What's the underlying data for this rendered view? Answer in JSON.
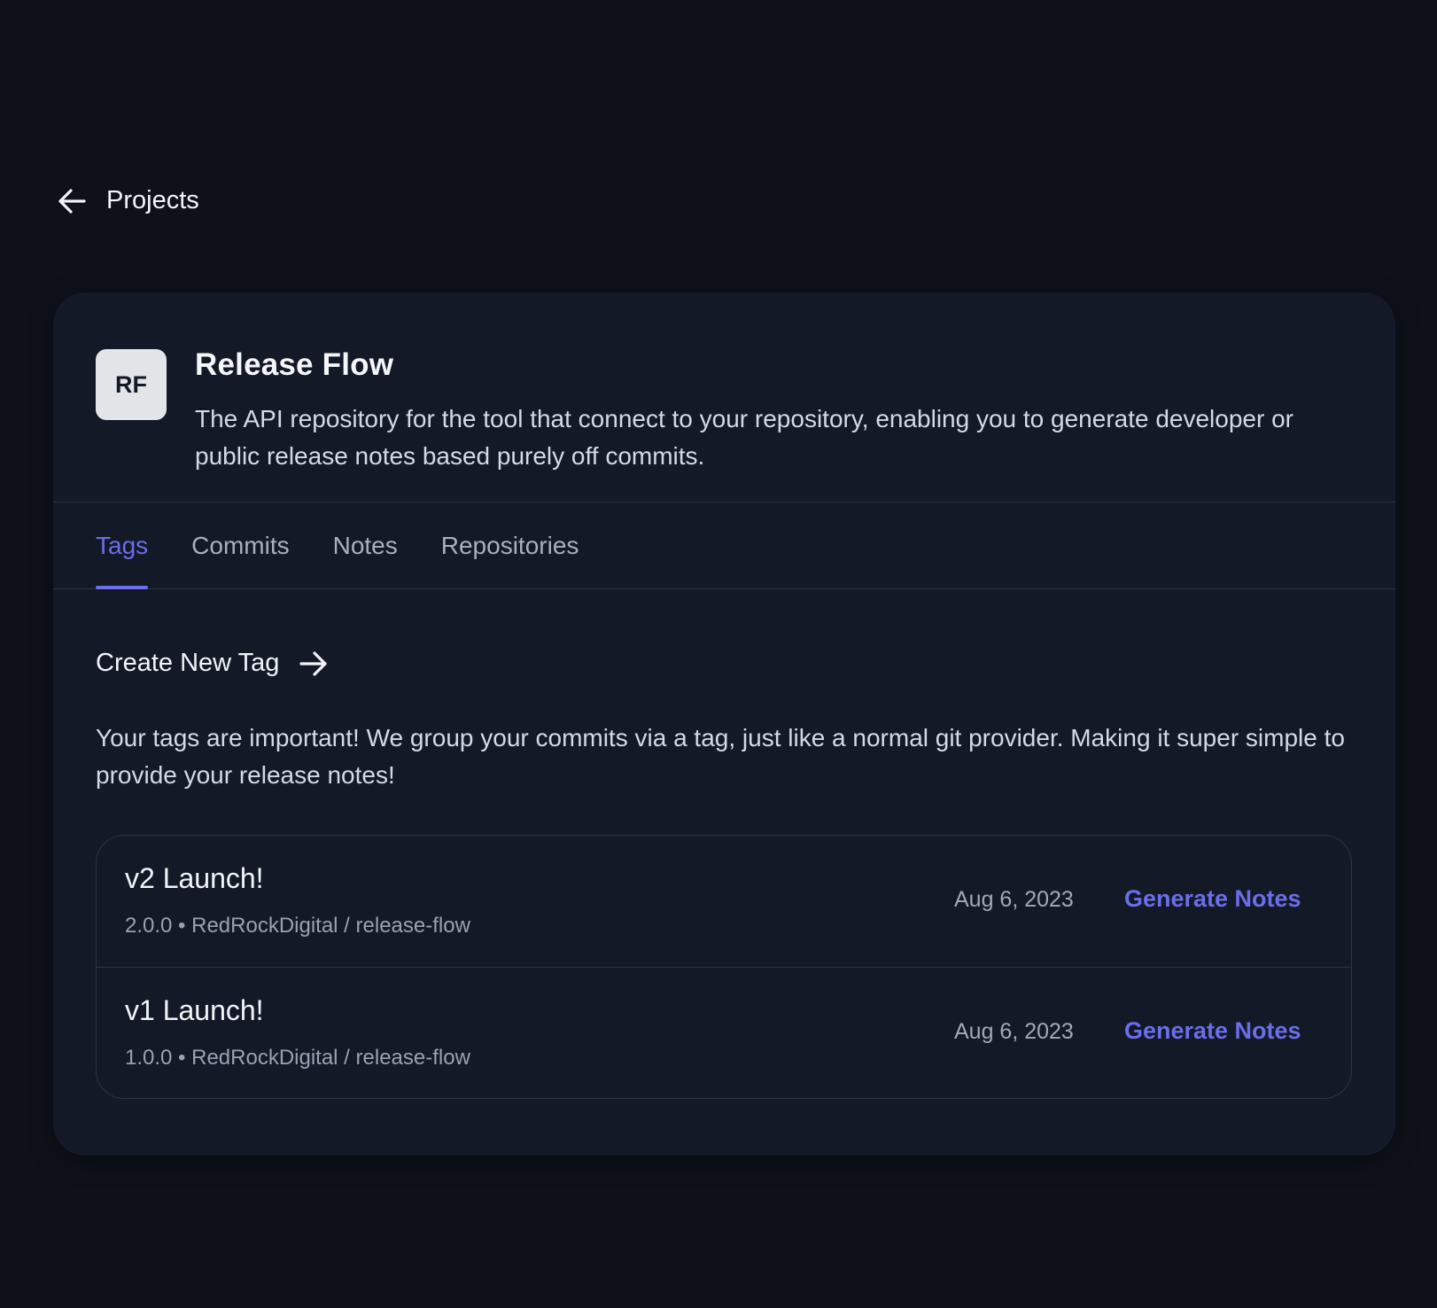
{
  "nav": {
    "back_label": "Projects"
  },
  "project": {
    "initials": "RF",
    "title": "Release Flow",
    "description": "The API repository for the tool that connect to your repository, enabling you to generate developer or public release notes based purely off commits."
  },
  "tabs": [
    {
      "label": "Tags",
      "active": true
    },
    {
      "label": "Commits",
      "active": false
    },
    {
      "label": "Notes",
      "active": false
    },
    {
      "label": "Repositories",
      "active": false
    }
  ],
  "tags_section": {
    "create_label": "Create New Tag",
    "description": "Your tags are important! We group your commits via a tag, just like a normal git provider. Making it super simple to provide your release notes!"
  },
  "tags": [
    {
      "name": "v2 Launch!",
      "meta": "2.0.0 • RedRockDigital / release-flow",
      "date": "Aug 6, 2023",
      "action": "Generate Notes"
    },
    {
      "name": "v1 Launch!",
      "meta": "1.0.0 • RedRockDigital / release-flow",
      "date": "Aug 6, 2023",
      "action": "Generate Notes"
    }
  ],
  "colors": {
    "background": "#0e111a",
    "card": "#131927",
    "accent": "#6a6ee8",
    "border": "#2c3344"
  },
  "icons": {
    "back": "arrow-left-icon",
    "create": "arrow-right-icon"
  }
}
